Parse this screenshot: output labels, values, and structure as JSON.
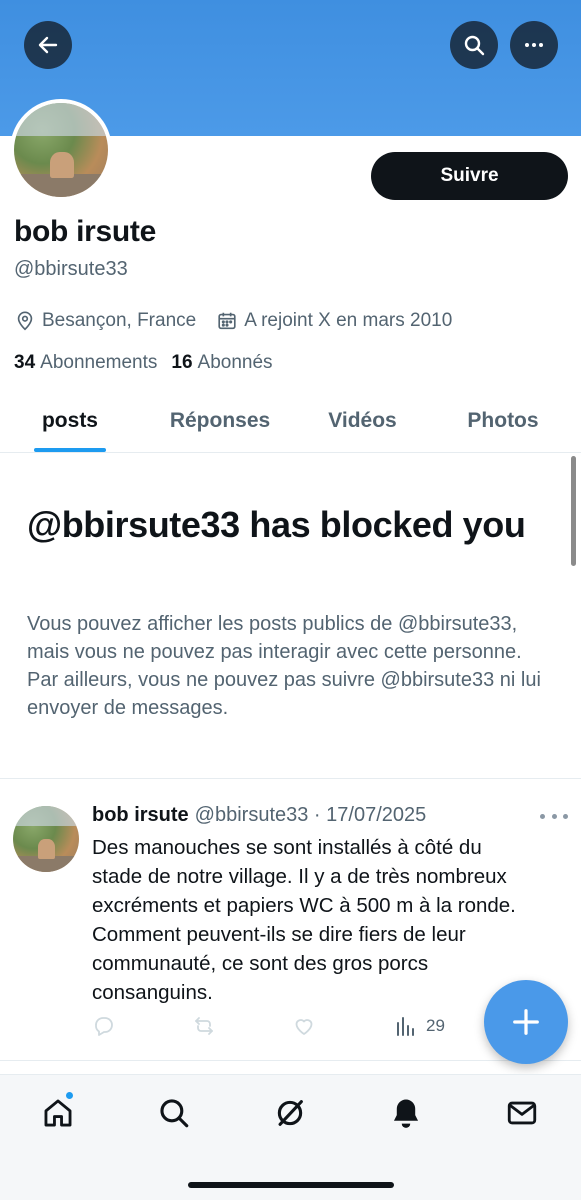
{
  "header": {
    "back_icon": "arrow-left-icon",
    "search_icon": "search-icon",
    "more_icon": "more-horizontal-icon",
    "banner_color": "#4c9ae8"
  },
  "profile": {
    "display_name": "bob irsute",
    "handle": "@bbirsute33",
    "follow_label": "Suivre",
    "location": "Besançon, France",
    "joined": "A rejoint X en mars 2010",
    "following_count": "34",
    "following_label": "Abonnements",
    "followers_count": "16",
    "followers_label": "Abonnés"
  },
  "tabs": [
    {
      "label": "posts",
      "active": true
    },
    {
      "label": "Réponses",
      "active": false
    },
    {
      "label": "Vidéos",
      "active": false
    },
    {
      "label": "Photos",
      "active": false
    }
  ],
  "blocked": {
    "title": "@bbirsute33 has blocked you",
    "description": "Vous pouvez afficher les posts publics de @bbirsute33, mais vous ne pouvez pas interagir avec cette personne. Par ailleurs, vous ne pouvez pas suivre @bbirsute33 ni lui envoyer de messages."
  },
  "post": {
    "author_name": "bob irsute",
    "author_handle_date": "@bbirsute33 · 17/07/2025",
    "text": "Des manouches se sont installés à côté du stade de notre village. Il y a de très nombreux excréments et papiers WC à 500 m à la ronde. Comment peuvent-ils se dire fiers de leur communauté, ce sont des gros porcs consanguins.",
    "views": "29"
  },
  "bottom_nav": [
    "home-icon",
    "search-icon",
    "grok-icon",
    "notifications-icon",
    "messages-icon"
  ],
  "colors": {
    "accent": "#1d9bf0",
    "fab": "#4a99e9",
    "text_primary": "#0f1419",
    "text_secondary": "#536471"
  }
}
